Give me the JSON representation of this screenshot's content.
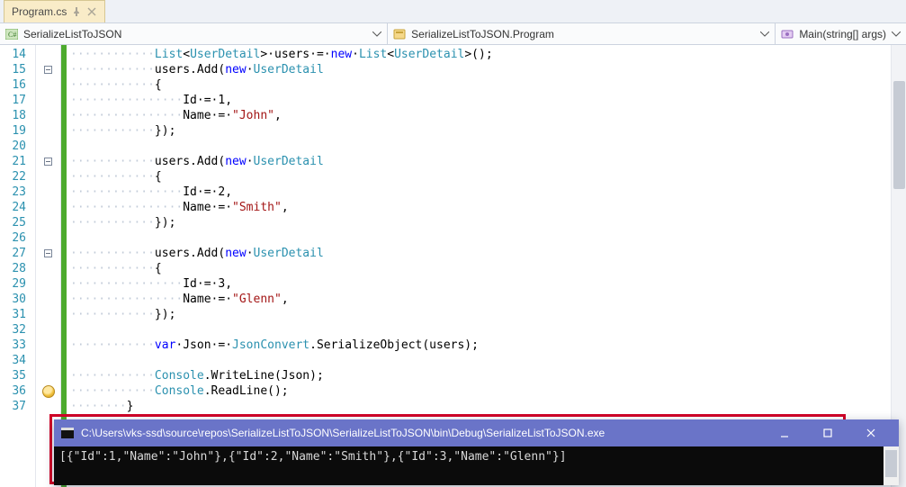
{
  "tab": {
    "label": "Program.cs"
  },
  "ctx": {
    "project": "SerializeListToJSON",
    "class": "SerializeListToJSON.Program",
    "method": "Main(string[] args)"
  },
  "lines": {
    "start": 14,
    "count": 24,
    "code": [
      [
        [
          "············",
          "ws"
        ],
        [
          "List",
          "tp"
        ],
        [
          "<",
          "pn"
        ],
        [
          "UserDetail",
          "tp"
        ],
        [
          ">·users·=·",
          "pn"
        ],
        [
          "new",
          "kw"
        ],
        [
          "·",
          "pn"
        ],
        [
          "List",
          "tp"
        ],
        [
          "<",
          "pn"
        ],
        [
          "UserDetail",
          "tp"
        ],
        [
          ">();",
          "pn"
        ]
      ],
      [
        [
          "············",
          "ws"
        ],
        [
          "users.Add(",
          "pn"
        ],
        [
          "new",
          "kw"
        ],
        [
          "·",
          "pn"
        ],
        [
          "UserDetail",
          "tp"
        ]
      ],
      [
        [
          "············",
          "ws"
        ],
        [
          "{",
          "pn"
        ]
      ],
      [
        [
          "················",
          "ws"
        ],
        [
          "Id·=·",
          "pn"
        ],
        [
          "1",
          "num"
        ],
        [
          ",",
          "pn"
        ]
      ],
      [
        [
          "················",
          "ws"
        ],
        [
          "Name·=·",
          "pn"
        ],
        [
          "\"John\"",
          "str"
        ],
        [
          ",",
          "pn"
        ]
      ],
      [
        [
          "············",
          "ws"
        ],
        [
          "});",
          "pn"
        ]
      ],
      [
        [
          "",
          "pn"
        ]
      ],
      [
        [
          "············",
          "ws"
        ],
        [
          "users.Add(",
          "pn"
        ],
        [
          "new",
          "kw"
        ],
        [
          "·",
          "pn"
        ],
        [
          "UserDetail",
          "tp"
        ]
      ],
      [
        [
          "············",
          "ws"
        ],
        [
          "{",
          "pn"
        ]
      ],
      [
        [
          "················",
          "ws"
        ],
        [
          "Id·=·",
          "pn"
        ],
        [
          "2",
          "num"
        ],
        [
          ",",
          "pn"
        ]
      ],
      [
        [
          "················",
          "ws"
        ],
        [
          "Name·=·",
          "pn"
        ],
        [
          "\"Smith\"",
          "str"
        ],
        [
          ",",
          "pn"
        ]
      ],
      [
        [
          "············",
          "ws"
        ],
        [
          "});",
          "pn"
        ]
      ],
      [
        [
          "",
          "pn"
        ]
      ],
      [
        [
          "············",
          "ws"
        ],
        [
          "users.Add(",
          "pn"
        ],
        [
          "new",
          "kw"
        ],
        [
          "·",
          "pn"
        ],
        [
          "UserDetail",
          "tp"
        ]
      ],
      [
        [
          "············",
          "ws"
        ],
        [
          "{",
          "pn"
        ]
      ],
      [
        [
          "················",
          "ws"
        ],
        [
          "Id·=·",
          "pn"
        ],
        [
          "3",
          "num"
        ],
        [
          ",",
          "pn"
        ]
      ],
      [
        [
          "················",
          "ws"
        ],
        [
          "Name·=·",
          "pn"
        ],
        [
          "\"Glenn\"",
          "str"
        ],
        [
          ",",
          "pn"
        ]
      ],
      [
        [
          "············",
          "ws"
        ],
        [
          "});",
          "pn"
        ]
      ],
      [
        [
          "",
          "pn"
        ]
      ],
      [
        [
          "············",
          "ws"
        ],
        [
          "var",
          "kw"
        ],
        [
          "·Json·=·",
          "pn"
        ],
        [
          "JsonConvert",
          "tp"
        ],
        [
          ".SerializeObject(users);",
          "pn"
        ]
      ],
      [
        [
          "",
          "pn"
        ]
      ],
      [
        [
          "············",
          "ws"
        ],
        [
          "Console",
          "tp"
        ],
        [
          ".WriteLine(Json);",
          "pn"
        ]
      ],
      [
        [
          "············",
          "ws"
        ],
        [
          "Console",
          "tp"
        ],
        [
          ".ReadLine();",
          "pn"
        ]
      ],
      [
        [
          "········",
          "ws"
        ],
        [
          "}",
          "pn"
        ]
      ]
    ],
    "foldMarkers": {
      "15": true,
      "21": true,
      "27": true
    },
    "bulb": 36
  },
  "console": {
    "title": "C:\\Users\\vks-ssd\\source\\repos\\SerializeListToJSON\\SerializeListToJSON\\bin\\Debug\\SerializeListToJSON.exe",
    "output": "[{\"Id\":1,\"Name\":\"John\"},{\"Id\":2,\"Name\":\"Smith\"},{\"Id\":3,\"Name\":\"Glenn\"}]"
  }
}
